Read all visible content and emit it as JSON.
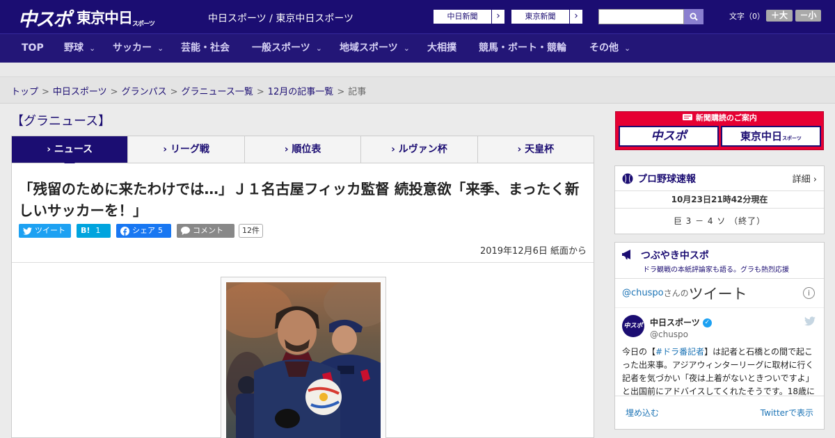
{
  "header": {
    "logo_main": "中スポ",
    "logo_tokyo": "東京中日",
    "logo_tokyo_small": "スポーツ",
    "site_title": "中日スポーツ / 東京中日スポーツ",
    "paper_links": [
      {
        "label": "中日新聞",
        "arrow": "›"
      },
      {
        "label": "東京新聞",
        "arrow": "›"
      }
    ],
    "search": {
      "placeholder": "",
      "icon": "search-icon"
    },
    "font_size_label": "文字（0）",
    "font_bigger": "＋大",
    "font_smaller": "－小"
  },
  "nav": {
    "items": [
      {
        "label": "TOP",
        "has_menu": false
      },
      {
        "label": "野球",
        "has_menu": true
      },
      {
        "label": "サッカー",
        "has_menu": true
      },
      {
        "label": "芸能・社会",
        "has_menu": false
      },
      {
        "label": "一般スポーツ",
        "has_menu": true
      },
      {
        "label": "地域スポーツ",
        "has_menu": true
      },
      {
        "label": "大相撲",
        "has_menu": false
      },
      {
        "label": "競馬・ボート・競輪",
        "has_menu": false
      },
      {
        "label": "その他",
        "has_menu": true
      }
    ],
    "chevron": "⌄"
  },
  "breadcrumb": {
    "items": [
      "トップ",
      "中日スポーツ",
      "グランパス",
      "グラニュース一覧",
      "12月の記事一覧"
    ],
    "current": "記事",
    "separator": ">"
  },
  "section_title": "【グラニュース】",
  "tabs": [
    {
      "label": "ニュース",
      "active": true
    },
    {
      "label": "リーグ戦",
      "active": false
    },
    {
      "label": "順位表",
      "active": false
    },
    {
      "label": "ルヴァン杯",
      "active": false
    },
    {
      "label": "天皇杯",
      "active": false
    }
  ],
  "tab_marker": "›",
  "article": {
    "headline": "「残留のために来たわけでは…」Ｊ１名古屋フィッカ監督 続投意欲「来季、まったく新しいサッカーを！」",
    "share": {
      "tweet": "ツイート",
      "hatena_label": "B!",
      "hatena_count": "1",
      "facebook": "シェア",
      "facebook_count": "5",
      "comment": "コメント",
      "comment_count": "12件"
    },
    "date": "2019年12月6日 紙面から"
  },
  "sidebar": {
    "subscription": {
      "head": "新聞購読のご案内",
      "logo_main": "中スポ",
      "logo_tokyo": "東京中日",
      "logo_tokyo_small": "スポーツ"
    },
    "baseball": {
      "title": "プロ野球速報",
      "detail": "詳細 ›",
      "time": "10月23日21時42分現在",
      "score": "巨 3 － 4 ソ （終了）"
    },
    "tsubuyaki": {
      "title": "つぶやき中スポ",
      "subtitle": "ドラ観戦の本紙評論家も語る。グラも熱烈応援",
      "handle": "@chuspo",
      "san": "さんの",
      "tweet_word": "ツイート",
      "info": "i",
      "user_name": "中日スポーツ",
      "user_badge": "✓",
      "user_acct": "@chuspo",
      "avatar_text": "中スポ",
      "body_pre": "今日の【",
      "body_tag": "#ドラ番記者",
      "body_post": "】は記者と石橋との間で起こった出来事。アジアウィンターリーグに取材に行く記者を気づかい「夜は上着がないときついですよ」と出国前にアドバイスしてくれたそうです。18歳に",
      "embed": "埋め込む",
      "view_on_twitter": "Twitterで表示"
    }
  },
  "colors": {
    "brand_navy": "#1b0d72",
    "nav_bg": "#231677",
    "accent_red": "#e60033",
    "twitter_blue": "#1da1f2",
    "facebook_blue": "#1877f2",
    "hatena_blue": "#00a4de"
  }
}
